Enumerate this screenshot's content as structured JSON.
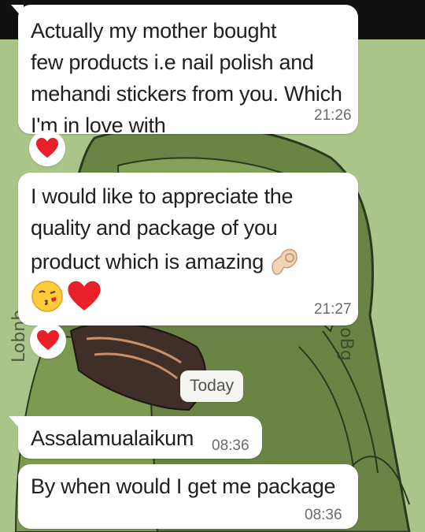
{
  "chat": {
    "messages": [
      {
        "text": "Actually my mother bought\nfew products i.e nail polish and\nmehandi stickers from you. Which\nI'm in love with",
        "time": "21:26",
        "reaction": "heart"
      },
      {
        "text_line1": "I would like to appreciate the",
        "text_line2": "quality and package of you",
        "text_line3": "product which is amazing",
        "emojis": [
          "ok-hand",
          "kiss-face",
          "heart"
        ],
        "time": "21:27",
        "reaction": "heart"
      },
      {
        "text": "Assalamualaikum",
        "time": "08:36"
      },
      {
        "text": "By when would I get me package",
        "time": "08:36"
      }
    ],
    "date_separator": "Today"
  },
  "wallpaper": {
    "watermark_right": "bonnoBg",
    "watermark_left": "Lobnb",
    "colors": {
      "background": "#a9c58a",
      "dark_green": "#5f7a3e",
      "bubble": "#ffffff",
      "heart": "#e8202a"
    }
  }
}
